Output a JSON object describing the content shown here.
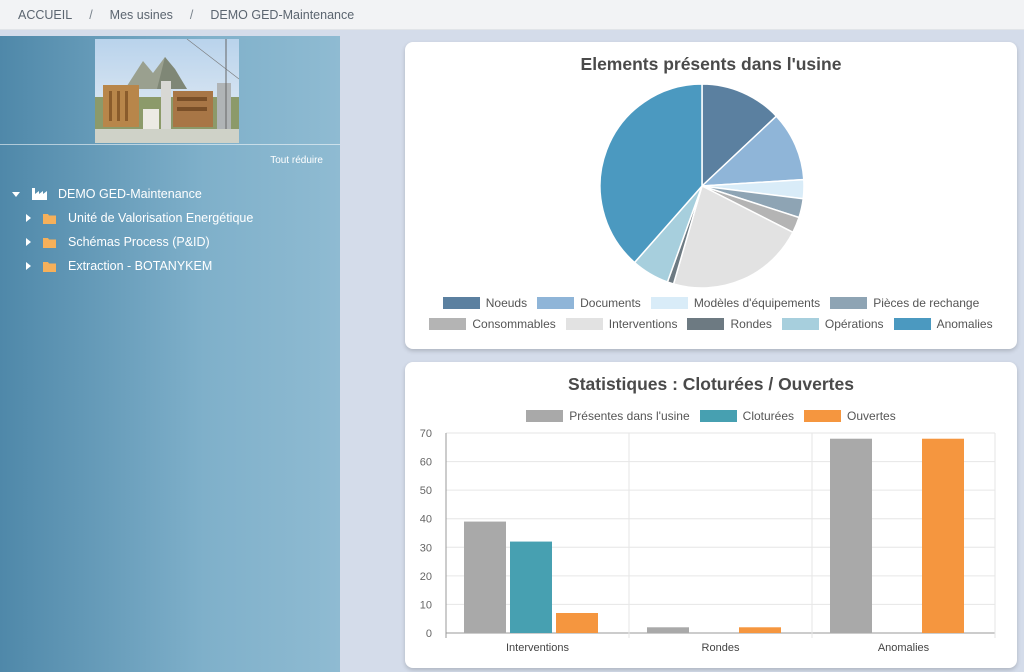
{
  "breadcrumb": {
    "home": "ACCUEIL",
    "sep": "/",
    "level1": "Mes usines",
    "level2": "DEMO GED-Maintenance"
  },
  "sidebar": {
    "collapse_all": "Tout réduire",
    "tree": {
      "root_label": "DEMO GED-Maintenance",
      "children": [
        {
          "label": "Unité de Valorisation Energétique"
        },
        {
          "label": "Schémas Process (P&ID)"
        },
        {
          "label": "Extraction - BOTANYKEM"
        }
      ]
    }
  },
  "colors": {
    "folder": "#f6b05a",
    "bar_present": "#a9a9a9",
    "bar_closed": "#47a0b1",
    "bar_open": "#f5963f"
  },
  "chart_data": [
    {
      "type": "pie",
      "title": "Elements présents dans l'usine",
      "labels": [
        "Noeuds",
        "Documents",
        "Modèles d'équipements",
        "Pièces de rechange",
        "Consommables",
        "Interventions",
        "Rondes",
        "Opérations",
        "Anomalies"
      ],
      "values": [
        13,
        11,
        3,
        3,
        2.5,
        22,
        1,
        6,
        38.5
      ],
      "colors": [
        "#5b80a0",
        "#8fb5d8",
        "#d9ecf8",
        "#8ea4b4",
        "#b4b4b4",
        "#e2e2e2",
        "#6d7a82",
        "#a7cfdd",
        "#4b99c0"
      ],
      "legend": "bottom"
    },
    {
      "type": "bar",
      "title": "Statistiques : Cloturées / Ouvertes",
      "categories": [
        "Interventions",
        "Rondes",
        "Anomalies"
      ],
      "series": [
        {
          "name": "Présentes dans l'usine",
          "values": [
            39,
            2,
            68
          ],
          "color": "#a9a9a9"
        },
        {
          "name": "Cloturées",
          "values": [
            32,
            0,
            0
          ],
          "color": "#47a0b1"
        },
        {
          "name": "Ouvertes",
          "values": [
            7,
            2,
            68
          ],
          "color": "#f5963f"
        }
      ],
      "ylim": [
        0,
        70
      ],
      "yticks": [
        "0",
        "10",
        "20",
        "30",
        "40",
        "50",
        "60",
        "70"
      ],
      "legend": "top",
      "grid": true
    }
  ]
}
